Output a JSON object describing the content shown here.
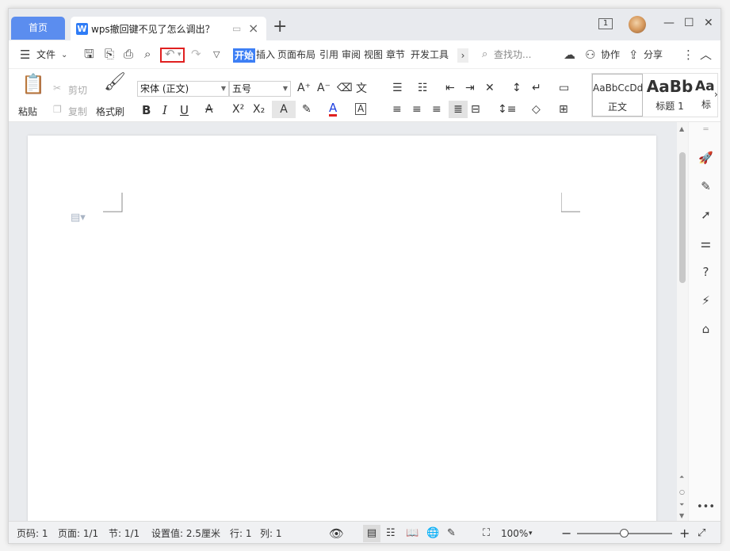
{
  "tabs": {
    "home": "首页",
    "document_title": "wps撤回键不见了怎么调出？",
    "new_tab": "+"
  },
  "window_controls": {
    "badge": "1",
    "minimize": "—",
    "maximize": "☐",
    "close": "✕"
  },
  "menu": {
    "file": "文件",
    "start": "开始",
    "items": [
      "插入",
      "页面布局",
      "引用",
      "审阅",
      "视图",
      "章节",
      "开发工具"
    ],
    "search_placeholder": "查找功...",
    "collaborate": "协作",
    "share": "分享"
  },
  "ribbon": {
    "paste": "粘贴",
    "cut": "剪切",
    "copy": "复制",
    "format_painter": "格式刷",
    "font_name": "宋体 (正文)",
    "font_size": "五号",
    "styles": [
      {
        "preview": "AaBbCcDd",
        "label": "正文"
      },
      {
        "preview": "AaBb",
        "label": "标题 1"
      },
      {
        "preview": "Aa",
        "label": "标"
      }
    ]
  },
  "status": {
    "page_num": "页码: 1",
    "pages": "页面: 1/1",
    "section": "节: 1/1",
    "setting": "设置值: 2.5厘米",
    "row": "行: 1",
    "col": "列: 1",
    "zoom": "100%",
    "zoom_fraction": 0.5
  },
  "colors": {
    "accent": "#3d7ff5",
    "home_tab": "#5b8def",
    "highlight": "#e02020"
  }
}
